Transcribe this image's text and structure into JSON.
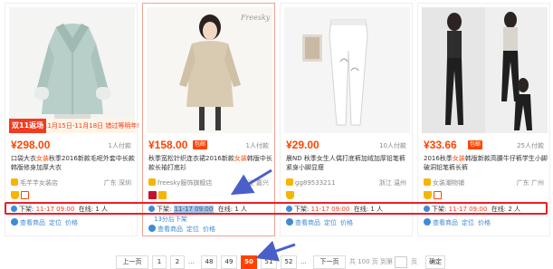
{
  "colors": {
    "accent": "#ff4400",
    "highlight_box": "#e8202a",
    "link": "#3f8bd6",
    "arrow": "#4a5fc8"
  },
  "products": [
    {
      "price": "¥298.00",
      "badge": "",
      "sold": "1人付款",
      "title_pre": "口袋大衣",
      "title_em": "女装",
      "title_post": "秋季2016新款毛呢外套中长款韩版修身加厚大衣",
      "shop": "毛芊芊女装店",
      "location": "广东 深圳",
      "promo_tag": "双11返场",
      "promo_text": "11月15日-11月18日 错过等明年!",
      "icons": [
        "crown-icon",
        "heart-icon"
      ],
      "status_label": "下架:",
      "time": "11-17 09:00",
      "online": "在线: 1 人",
      "tip": "",
      "links": [
        "查看商品",
        "定位",
        "价格"
      ]
    },
    {
      "price": "¥158.00",
      "badge": "包邮",
      "sold": "1人付款",
      "title_pre": "秋季宽松针织连衣裙2016新款",
      "title_em": "女装",
      "title_post": "韩版中长款长袖打底衫",
      "shop": "freesky服饰旗舰店",
      "location": "浙江 嘉兴",
      "promo_tag": "",
      "promo_text": "",
      "icons": [
        "tmall-icon",
        "store-icon"
      ],
      "status_label": "下架:",
      "time": "11-17 09:00",
      "online": "在线: 1 人",
      "tip": "13分后下架",
      "links": [
        "查看商品",
        "定位",
        "价格"
      ]
    },
    {
      "price": "¥29.00",
      "badge": "",
      "sold": "10人付款",
      "title_pre": "晨ND 秋季女生人偶打底裤",
      "title_em": "",
      "title_post": "加绒加厚铅笔裤紧身小脚显瘦",
      "shop": "gg89533211",
      "location": "浙江 温州",
      "promo_tag": "",
      "promo_text": "",
      "icons": [
        "crown-icon"
      ],
      "status_label": "下架:",
      "time": "11-17 09:00",
      "online": "在线: 1 人",
      "tip": "",
      "links": [
        "查看商品",
        "定位",
        "价格"
      ]
    },
    {
      "price": "¥33.66",
      "badge": "包邮",
      "sold": "25人付款",
      "title_pre": "2016秋季",
      "title_em": "女装",
      "title_post": "韩版新款高腰牛仔裤学生小脚破洞铅笔裤长裤",
      "shop": "女装潮物铺",
      "location": "广东 广州",
      "promo_tag": "",
      "promo_text": "",
      "icons": [
        "crown-icon",
        "heart-icon"
      ],
      "status_label": "下架:",
      "time": "11-17 09:00",
      "online": "在线: 2 人",
      "tip": "",
      "links": [
        "查看商品",
        "定位",
        "价格"
      ]
    }
  ],
  "pager": {
    "prev": "上一页",
    "pages": [
      "1",
      "2",
      "48",
      "49",
      "50",
      "51",
      "52"
    ],
    "active": "50",
    "dots": "...",
    "next": "下一页",
    "total": "共 100 页",
    "goto": "到第",
    "page_unit": "页",
    "confirm": "确定"
  }
}
